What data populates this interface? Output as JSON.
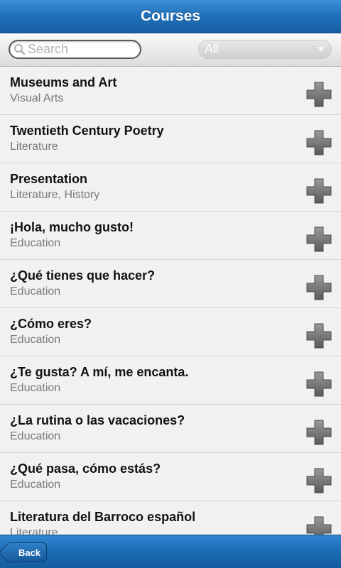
{
  "header": {
    "title": "Courses"
  },
  "filter": {
    "search_placeholder": "Search",
    "category_selected": "All"
  },
  "courses": [
    {
      "name": "Museums and Art",
      "subject": "Visual Arts"
    },
    {
      "name": "Twentieth Century Poetry",
      "subject": "Literature"
    },
    {
      "name": "Presentation",
      "subject": "Literature, History"
    },
    {
      "name": "¡Hola, mucho gusto!",
      "subject": "Education"
    },
    {
      "name": "¿Qué tienes que hacer?",
      "subject": "Education"
    },
    {
      "name": "¿Cómo eres?",
      "subject": "Education"
    },
    {
      "name": "¿Te gusta? A mí, me encanta.",
      "subject": "Education"
    },
    {
      "name": "¿La rutina o las vacaciones?",
      "subject": "Education"
    },
    {
      "name": "¿Qué pasa, cómo estás?",
      "subject": "Education"
    },
    {
      "name": "Literatura del Barroco español",
      "subject": "Literature"
    }
  ],
  "footer": {
    "back_label": "Back"
  },
  "icons": {
    "add": "plus-icon",
    "search": "search-icon",
    "dropdown": "chevron-down-icon",
    "back": "back-arrow-button"
  },
  "colors": {
    "bar_blue": "#1f6fb8",
    "list_bg": "#f1f1f1",
    "subject_gray": "#7a7a7a",
    "plus_gray": "#6e6e6e"
  }
}
